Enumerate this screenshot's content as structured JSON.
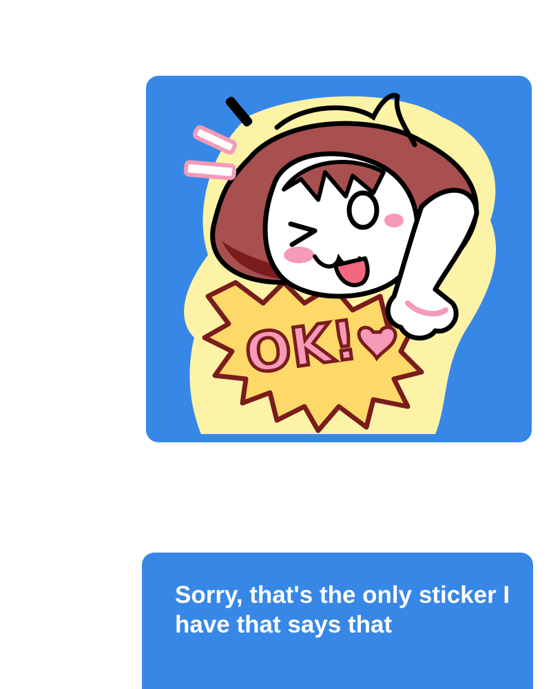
{
  "conversation": {
    "messages": [
      {
        "type": "sticker",
        "sticker_name": "ok-wink-girl-sticker",
        "sticker_text": "OK!"
      },
      {
        "type": "text",
        "text": "Sorry, that's the only sticker I have that says that"
      }
    ]
  },
  "colors": {
    "bubble": "#3787e6",
    "text": "#ffffff",
    "hair": "#a84f4f",
    "burst": "#fde27a",
    "pink": "#f59ab7"
  }
}
